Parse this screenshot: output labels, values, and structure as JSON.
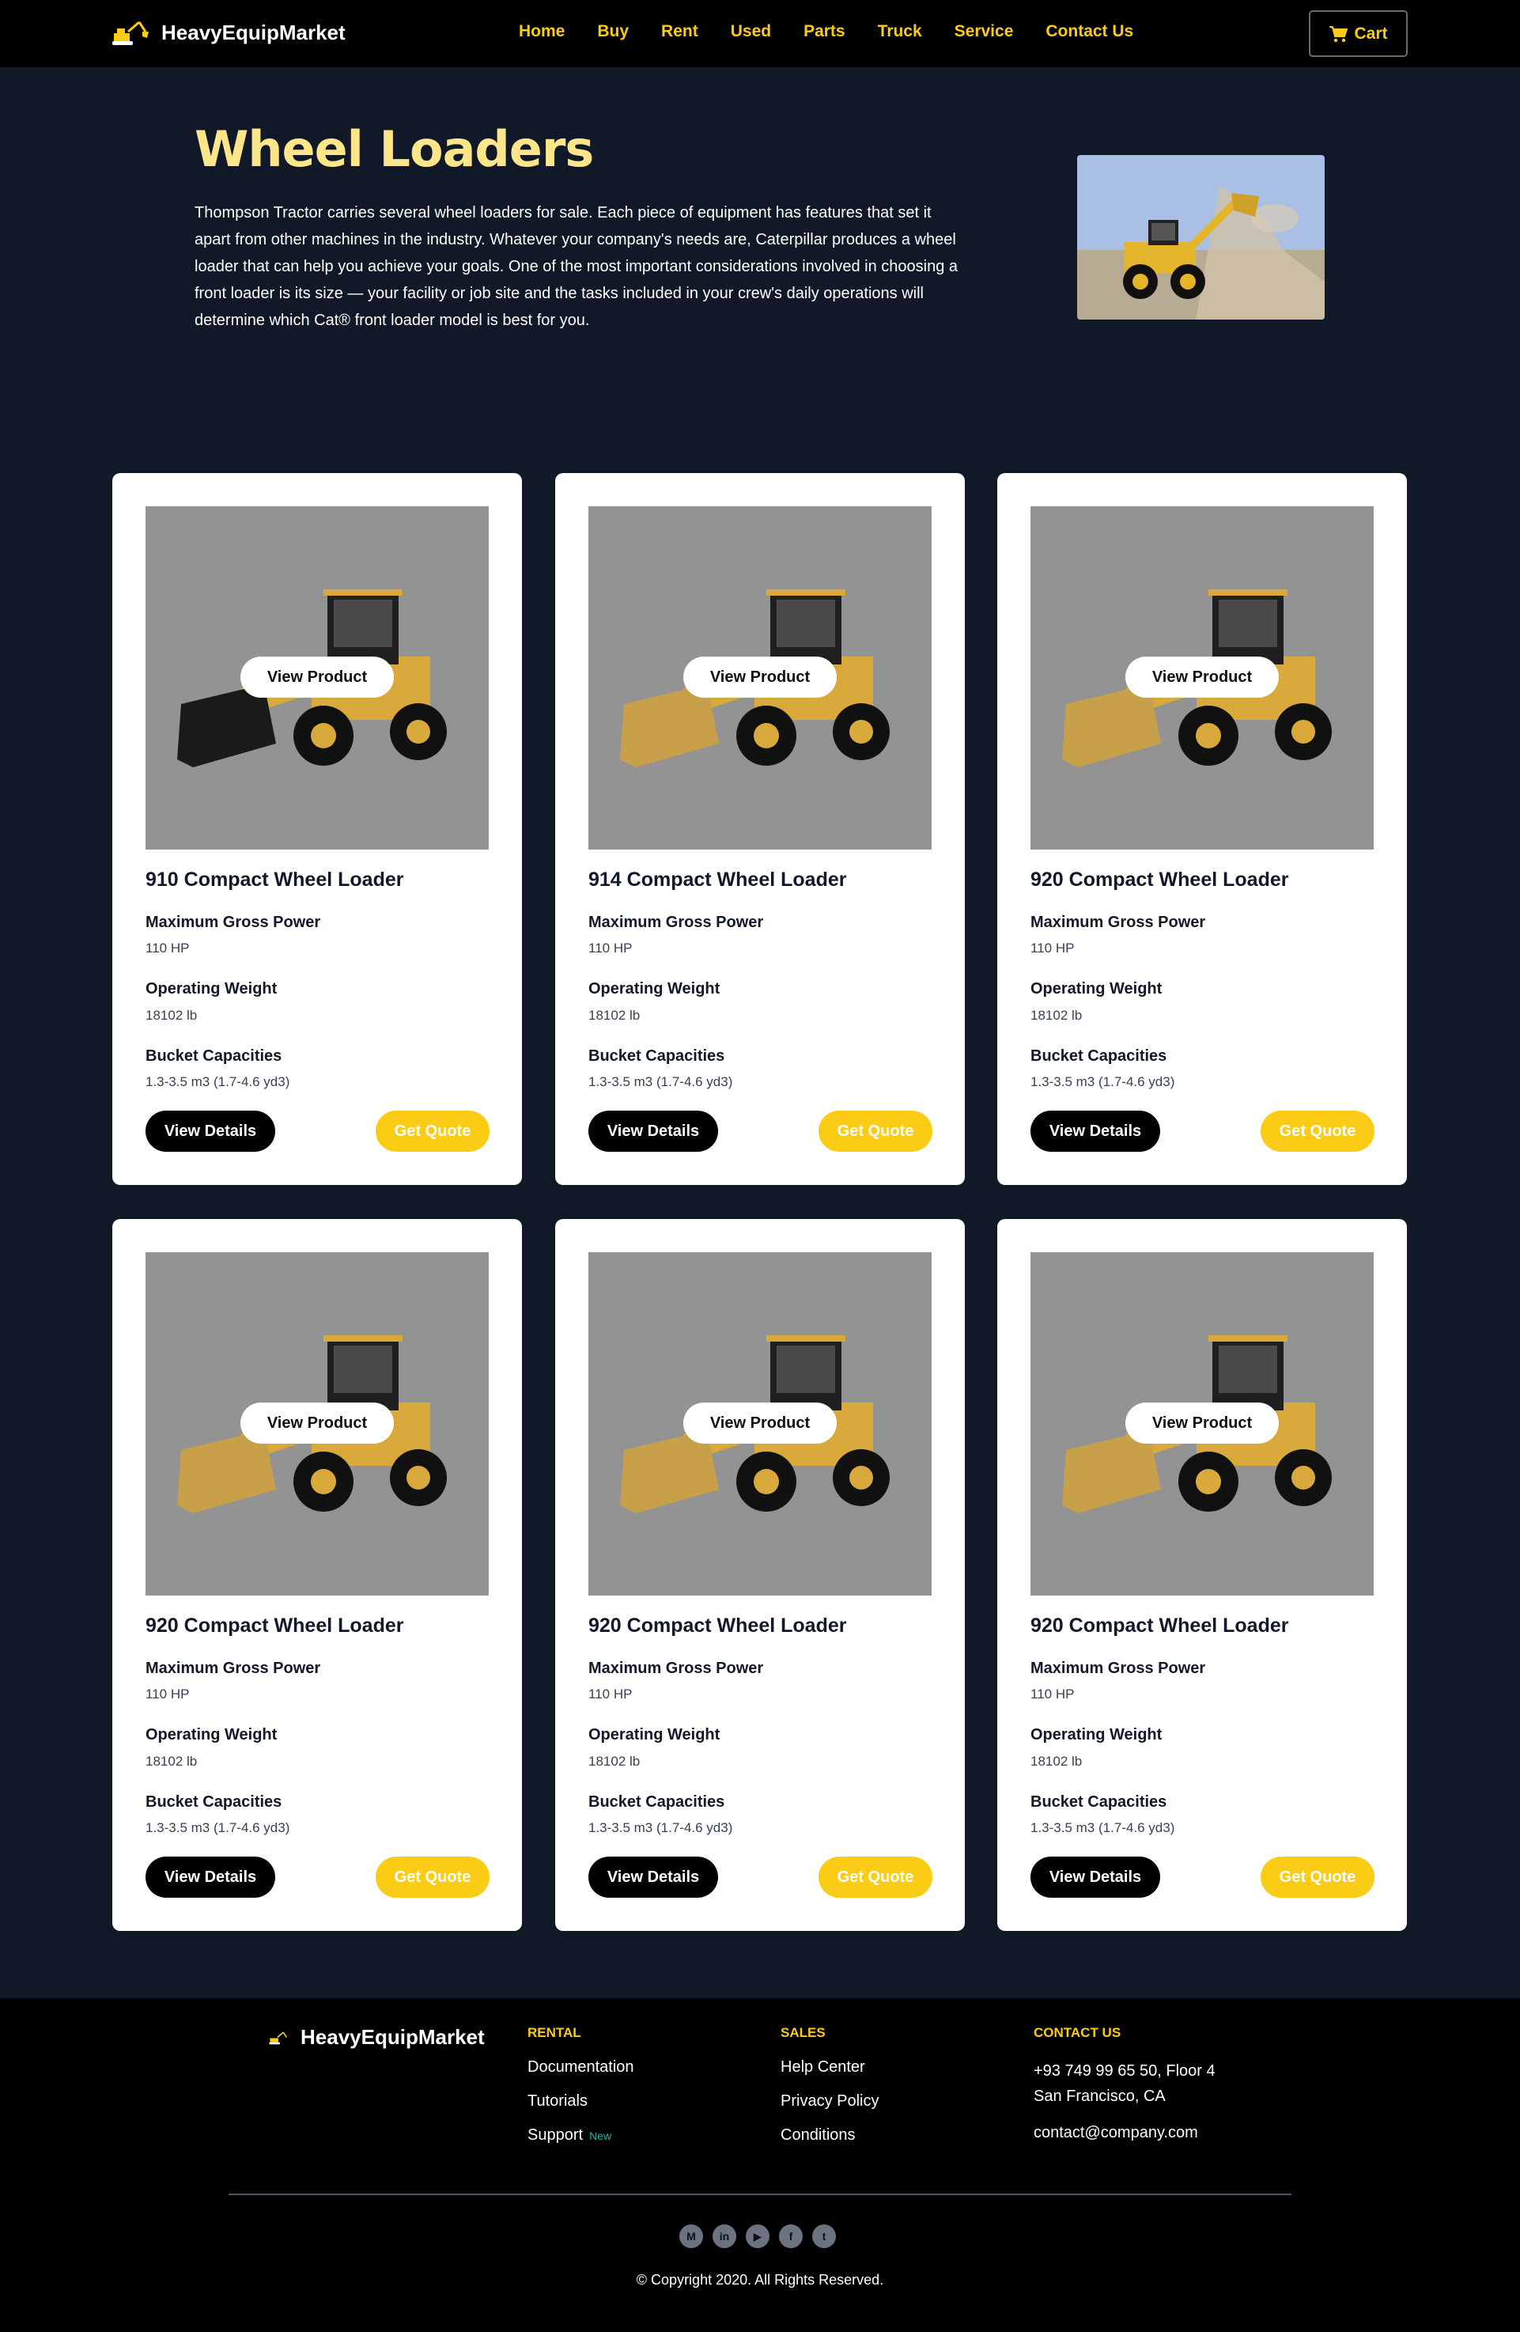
{
  "nav": {
    "brand": "HeavyEquipMarket",
    "links": [
      "Home",
      "Buy",
      "Rent",
      "Used",
      "Parts",
      "Truck",
      "Service",
      "Contact Us"
    ],
    "cart": "Cart"
  },
  "hero": {
    "title": "Wheel Loaders",
    "text": "Thompson Tractor carries several wheel loaders for sale. Each piece of equipment has features that set it apart from other machines in the industry. Whatever your company's needs are, Caterpillar produces a wheel loader that can help you achieve your goals. One of the most important considerations involved in choosing a front loader is its size — your facility or job site and the tasks included in your crew's daily operations will determine which Cat® front loader model is best for you."
  },
  "products": [
    {
      "title": "910 Compact Wheel Loader",
      "view": "View Product",
      "power_label": "Maximum Gross Power",
      "power": "110 HP",
      "weight_label": "Operating Weight",
      "weight": "18102 lb",
      "bucket_label": "Bucket Capacities",
      "bucket": "1.3-3.5 m3 (1.7-4.6 yd3)",
      "details": "View Details",
      "quote": "Get Quote"
    },
    {
      "title": "914 Compact Wheel Loader",
      "view": "View Product",
      "power_label": "Maximum Gross Power",
      "power": "110 HP",
      "weight_label": "Operating Weight",
      "weight": "18102 lb",
      "bucket_label": "Bucket Capacities",
      "bucket": "1.3-3.5 m3 (1.7-4.6 yd3)",
      "details": "View Details",
      "quote": "Get Quote"
    },
    {
      "title": "920 Compact Wheel Loader",
      "view": "View Product",
      "power_label": "Maximum Gross Power",
      "power": "110 HP",
      "weight_label": "Operating Weight",
      "weight": "18102 lb",
      "bucket_label": "Bucket Capacities",
      "bucket": "1.3-3.5 m3 (1.7-4.6 yd3)",
      "details": "View Details",
      "quote": "Get Quote"
    },
    {
      "title": "920 Compact Wheel Loader",
      "view": "View Product",
      "power_label": "Maximum Gross Power",
      "power": "110 HP",
      "weight_label": "Operating Weight",
      "weight": "18102 lb",
      "bucket_label": "Bucket Capacities",
      "bucket": "1.3-3.5 m3 (1.7-4.6 yd3)",
      "details": "View Details",
      "quote": "Get Quote"
    },
    {
      "title": "920 Compact Wheel Loader",
      "view": "View Product",
      "power_label": "Maximum Gross Power",
      "power": "110 HP",
      "weight_label": "Operating Weight",
      "weight": "18102 lb",
      "bucket_label": "Bucket Capacities",
      "bucket": "1.3-3.5 m3 (1.7-4.6 yd3)",
      "details": "View Details",
      "quote": "Get Quote"
    },
    {
      "title": "920 Compact Wheel Loader",
      "view": "View Product",
      "power_label": "Maximum Gross Power",
      "power": "110 HP",
      "weight_label": "Operating Weight",
      "weight": "18102 lb",
      "bucket_label": "Bucket Capacities",
      "bucket": "1.3-3.5 m3 (1.7-4.6 yd3)",
      "details": "View Details",
      "quote": "Get Quote"
    }
  ],
  "footer": {
    "brand": "HeavyEquipMarket",
    "rental": {
      "heading": "RENTAL",
      "links": [
        "Documentation",
        "Tutorials",
        "Support"
      ],
      "new_badge": "New"
    },
    "sales": {
      "heading": "SALES",
      "links": [
        "Help Center",
        "Privacy Policy",
        "Conditions"
      ]
    },
    "contact": {
      "heading": "CONTACT US",
      "address_line1": "+93 749 99 65 50, Floor 4",
      "address_line2": "San Francisco, CA",
      "email": "contact@company.com"
    },
    "socials": [
      "medium-icon",
      "linkedin-icon",
      "youtube-icon",
      "facebook-icon",
      "twitter-icon"
    ],
    "copyright": "© Copyright 2020. All Rights Reserved."
  },
  "colors": {
    "accent": "#facc15",
    "hero_title": "#fde68a",
    "background": "#111827",
    "nav": "#000000"
  }
}
